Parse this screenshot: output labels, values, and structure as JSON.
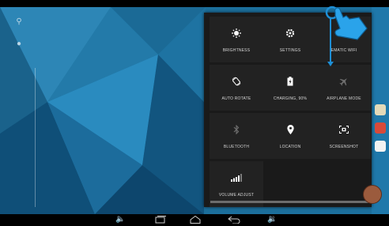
{
  "quick_settings": {
    "tiles": [
      {
        "label": "BRIGHTNESS",
        "icon": "brightness-icon"
      },
      {
        "label": "SETTINGS",
        "icon": "gear-icon"
      },
      {
        "label": "EMATIC WIFI",
        "icon": "wifi-icon"
      },
      {
        "label": "AUTO ROTATE",
        "icon": "rotate-icon"
      },
      {
        "label": "CHARGING, 90%",
        "icon": "battery-charging-icon"
      },
      {
        "label": "AIRPLANE MODE",
        "icon": "airplane-icon"
      },
      {
        "label": "BLUETOOTH",
        "icon": "bluetooth-icon"
      },
      {
        "label": "LOCATION",
        "icon": "location-icon"
      },
      {
        "label": "SCREENSHOT",
        "icon": "screenshot-icon"
      },
      {
        "label": "VOLUME ADJUST",
        "icon": "volume-bars-icon"
      }
    ],
    "battery_level_percent": 90
  },
  "navbar": {
    "icons": [
      "volume-down-icon",
      "recent-apps-icon",
      "home-icon",
      "back-icon",
      "volume-up-icon"
    ]
  },
  "colors": {
    "wallpaper": "#1c6f9c",
    "panel": "#1a1a1a",
    "tile": "#222222",
    "swipe_arrow": "#1e8fd6"
  }
}
